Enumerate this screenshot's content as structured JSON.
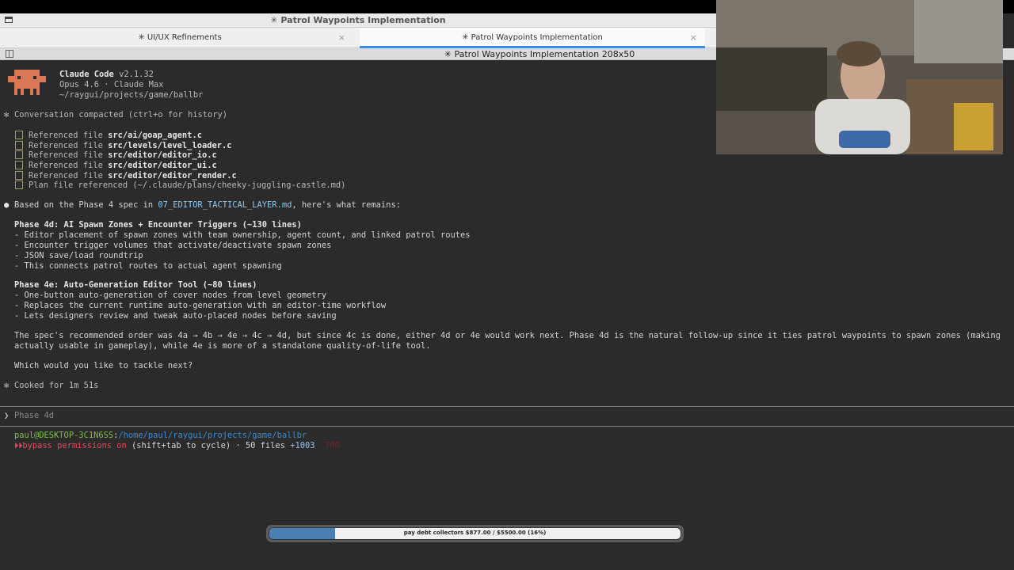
{
  "window": {
    "title": "✳ Patrol Waypoints Implementation"
  },
  "tabs": [
    {
      "label": "✳ UI/UX Refinements",
      "close": "×"
    },
    {
      "label": "✳ Patrol Waypoints Implementation",
      "close": "×"
    }
  ],
  "pane": {
    "title": "✳ Patrol Waypoints Implementation 208x50"
  },
  "header": {
    "product": "Claude Code",
    "version": "v2.1.32",
    "model": "Opus 4.6 · Claude Max",
    "path": "~/raygui/projects/game/ballbr"
  },
  "compacted": {
    "bullet": "✻",
    "text": "Conversation compacted (ctrl+o for history)"
  },
  "references": [
    {
      "prefix": "Referenced file ",
      "file": "src/ai/goap_agent.c"
    },
    {
      "prefix": "Referenced file ",
      "file": "src/levels/level_loader.c"
    },
    {
      "prefix": "Referenced file ",
      "file": "src/editor/editor_io.c"
    },
    {
      "prefix": "Referenced file ",
      "file": "src/editor/editor_ui.c"
    },
    {
      "prefix": "Referenced file ",
      "file": "src/editor/editor_render.c"
    },
    {
      "prefix": "Plan file referenced (~/.claude/plans/cheeky-juggling-castle.md)",
      "file": ""
    }
  ],
  "response": {
    "bullet": "●",
    "intro_pre": "Based on the Phase 4 spec in ",
    "intro_file": "07_EDITOR_TACTICAL_LAYER.md",
    "intro_post": ", here's what remains:",
    "phase_4d_title": "Phase 4d: AI Spawn Zones + Encounter Triggers (~130 lines)",
    "phase_4d_items": [
      "- Editor placement of spawn zones with team ownership, agent count, and linked patrol routes",
      "- Encounter trigger volumes that activate/deactivate spawn zones",
      "- JSON save/load roundtrip",
      "- This connects patrol routes to actual agent spawning"
    ],
    "phase_4e_title": "Phase 4e: Auto-Generation Editor Tool (~80 lines)",
    "phase_4e_items": [
      "- One-button auto-generation of cover nodes from level geometry",
      "- Replaces the current runtime auto-generation with an editor-time workflow",
      "- Lets designers review and tweak auto-placed nodes before saving"
    ],
    "order_line1": "The spec's recommended order was 4a → 4b → 4e → 4c → 4d, but since 4c is done, either 4d or 4e would work next. Phase 4d is the natural follow-up since it ties patrol waypoints to spawn zones (making",
    "order_line2": "actually usable in gameplay), while 4e is more of a standalone quality-of-life tool.",
    "question": "Which would you like to tackle next?"
  },
  "cooked": {
    "bullet": "✻",
    "text": "Cooked for 1m 51s"
  },
  "prompt": {
    "symbol": "❯",
    "placeholder": "Phase 4d"
  },
  "statusline": {
    "user_host": "paul@DESKTOP-3C1N6SS",
    "colon": ":",
    "cwd": "/home/paul/raygui/projects/game/ballbr",
    "mode_icon": "⏵⏵",
    "mode": "bypass permissions on",
    "mode_hint": " (shift+tab to cycle) · 50 files ",
    "added": "+1003",
    "removed": "-700"
  },
  "progress": {
    "label": "pay debt collectors $877.00 / $5500.00 (16%)",
    "fraction": 0.16
  },
  "colors": {
    "accent": "#3b8eea",
    "mascot": "#d97757",
    "progress": "#4a7fb4"
  }
}
